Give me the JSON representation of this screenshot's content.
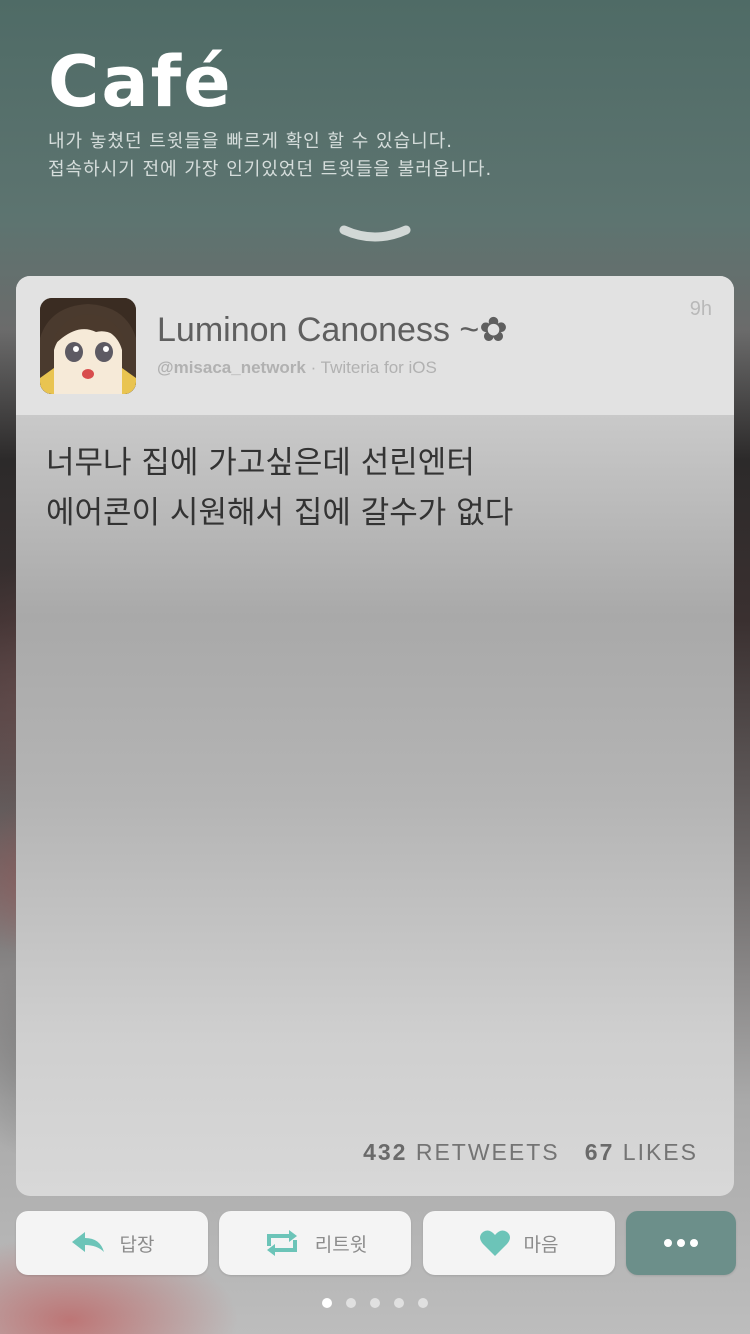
{
  "header": {
    "app_title": "Café",
    "subtitle_line1": "내가 놓쳤던 트윗들을 빠르게 확인 할 수 있습니다.",
    "subtitle_line2": "접속하시기 전에 가장 인기있었던 트윗들을 불러옵니다."
  },
  "tweet": {
    "display_name": "Luminon Canoness ~✿",
    "handle": "@misaca_network",
    "source": " · Twiteria for iOS",
    "timestamp": "9h",
    "text_line1": "너무나 집에 가고싶은데 선린엔터",
    "text_line2": "에어콘이 시원해서 집에 갈수가 없다",
    "retweets_count": "432",
    "retweets_label": "RETWEETS",
    "likes_count": "67",
    "likes_label": "LIKES"
  },
  "actions": {
    "reply_label": "답장",
    "retweet_label": "리트윗",
    "like_label": "마음",
    "more_icon": "more-dots-icon"
  },
  "pagination": {
    "page_count": 5,
    "current_page": 1
  },
  "colors": {
    "accent": "#6cc4b8",
    "more_button": "#6c8f8a"
  }
}
